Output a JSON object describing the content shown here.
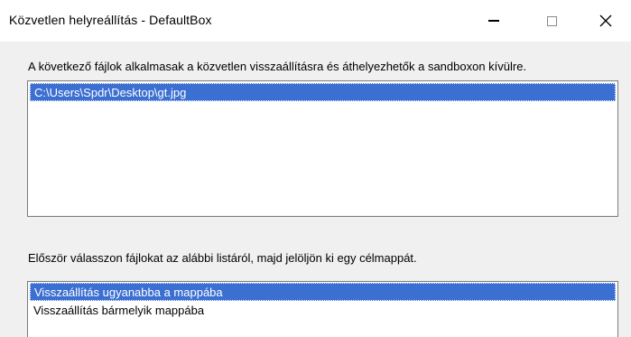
{
  "window": {
    "title": "Közvetlen helyreállítás - DefaultBox"
  },
  "files_section": {
    "instruction": "A következő fájlok alkalmasak a közvetlen visszaállításra és áthelyezhetők a sandboxon kívülre.",
    "files": [
      {
        "path": "C:\\Users\\Spdr\\Desktop\\gt.jpg",
        "selected": true
      }
    ]
  },
  "restore_section": {
    "instruction": "Először válasszon fájlokat az alábbi listáról, majd jelöljön ki egy célmappát.",
    "options": [
      {
        "label": "Visszaállítás ugyanabba a mappába",
        "selected": true
      },
      {
        "label": "Visszaállítás bármelyik mappába",
        "selected": false
      }
    ]
  },
  "colors": {
    "selection": "#3b6fd1",
    "window_bg": "#f0f0f0",
    "titlebar_bg": "#ffffff"
  },
  "icons": [
    "minimize-icon",
    "maximize-icon",
    "close-icon"
  ]
}
